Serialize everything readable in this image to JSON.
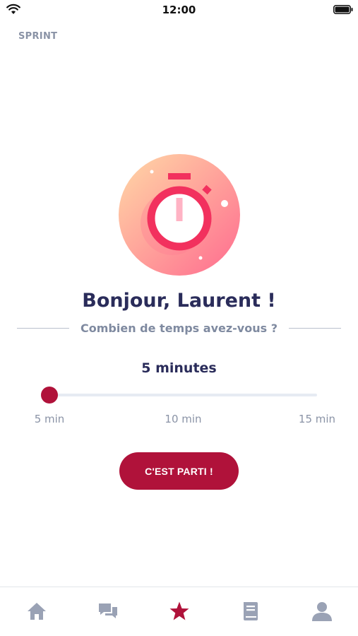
{
  "status_bar": {
    "time": "12:00"
  },
  "header": {
    "title": "SPRINT"
  },
  "hero": {
    "icon": "stopwatch-icon"
  },
  "greeting": "Bonjour, Laurent !",
  "subtitle": "Combien de temps avez-vous ?",
  "duration": {
    "label": "5 minutes",
    "value": 5,
    "min": 5,
    "max": 15
  },
  "slider": {
    "labels": [
      "5 min",
      "10 min",
      "15 min"
    ]
  },
  "cta": {
    "label": "C'EST PARTI !"
  },
  "tab_bar": {
    "items": [
      {
        "icon": "home-icon",
        "active": false
      },
      {
        "icon": "chat-icon",
        "active": false
      },
      {
        "icon": "star-icon",
        "active": true
      },
      {
        "icon": "book-icon",
        "active": false
      },
      {
        "icon": "profile-icon",
        "active": false
      }
    ]
  },
  "colors": {
    "accent": "#b0123a",
    "title": "#2a2c5a",
    "muted": "#8a93a6",
    "tab_inactive": "#9aa2b5",
    "hero_gradient_start": "#ffd6a5",
    "hero_gradient_end": "#ff6f8e",
    "stopwatch": "#f2315e"
  }
}
